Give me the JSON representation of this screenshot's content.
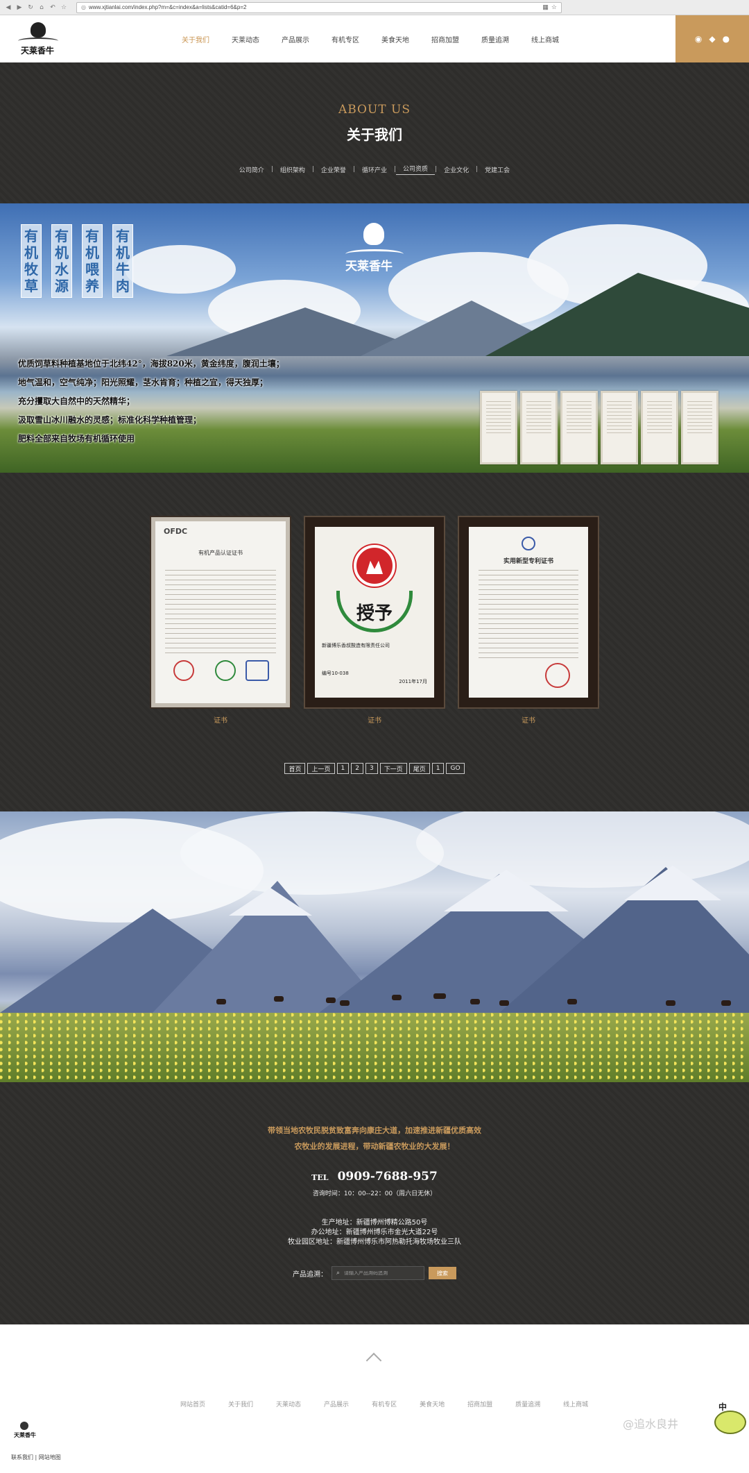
{
  "browser": {
    "url": "www.xjtianlai.com/index.php?m=&c=index&a=lists&catid=6&p=2"
  },
  "header": {
    "logo_text": "天莱香牛",
    "nav": [
      "关于我们",
      "天莱动态",
      "产品展示",
      "有机专区",
      "美食天地",
      "招商加盟",
      "质量追溯",
      "线上商城"
    ],
    "active_nav": "关于我们",
    "social_icons": [
      "weibo-icon",
      "qq-icon",
      "wechat-icon"
    ],
    "accent_color": "#c99a5c"
  },
  "about": {
    "en_title": "ABOUT US",
    "cn_title": "关于我们",
    "subnav": [
      "公司简介",
      "组织架构",
      "企业荣誉",
      "循环产业",
      "公司资质",
      "企业文化",
      "党建工会"
    ],
    "active_subnav": "公司资质"
  },
  "banner": {
    "tags": [
      "有机牧草",
      "有机水源",
      "有机喂养",
      "有机牛肉"
    ],
    "logo_text": "天莱香牛",
    "lines": [
      "优质饲草料种植基地位于北纬42°，海拔820米，黄金纬度，腹润土壤；",
      "地气温和，空气纯净；阳光照耀，茎水肯育；种植之宜，得天独厚；",
      "充分攫取大自然中的天然精华；",
      "汲取雪山冰川融水的灵感；标准化科学种植管理；",
      "肥料全部来自牧场有机循环使用"
    ]
  },
  "certificates": {
    "items": [
      {
        "caption": "证书",
        "header": "OFDC",
        "title": "有机产品认证证书"
      },
      {
        "caption": "证书",
        "award": "授予",
        "issuer": "新疆博乐香叔酸造有限责任公司",
        "number": "编号10-038",
        "date": "2011年17月"
      },
      {
        "caption": "证书",
        "title": "实用新型专利证书"
      }
    ]
  },
  "pager": [
    "首页",
    "上一页",
    "1",
    "2",
    "3",
    "下一页",
    "尾页",
    "1",
    "GO"
  ],
  "footer": {
    "slogan_lines": [
      "带领当地农牧民脱贫致富奔向康庄大道，加速推进新疆优质高效",
      "农牧业的发展进程，带动新疆农牧业的大发展！"
    ],
    "tel_label": "TEL",
    "tel": "0909-7688-957",
    "hours": "咨询时间：10：00--22：00（周六日无休）",
    "addresses": [
      "生产地址：新疆博州博精公路50号",
      "办公地址：新疆博州博乐市金光大道22号",
      "牧业园区地址：新疆博州博乐市阿热勒托海牧场牧业三队"
    ],
    "search_label": "产品追溯：",
    "search_placeholder": "请输入产品溯码追溯",
    "search_button": "搜索"
  },
  "bottom": {
    "nav": [
      "网站首页",
      "关于我们",
      "天莱动态",
      "产品展示",
      "有机专区",
      "美食天地",
      "招商加盟",
      "质量追溯",
      "线上商城"
    ],
    "logo_text": "天莱香牛",
    "links": "联系我们 | 网站地图",
    "watermark": "@追水良井",
    "mascot_text": "中"
  }
}
